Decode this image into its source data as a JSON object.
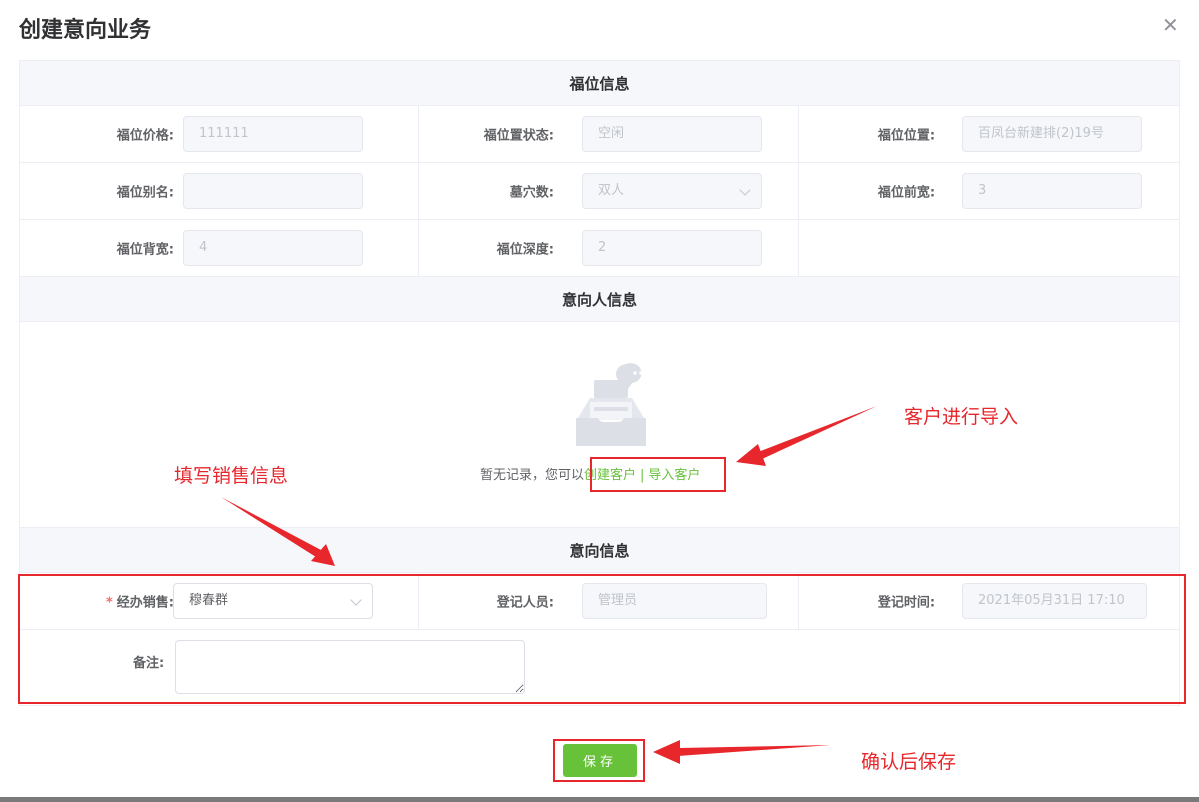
{
  "dialog": {
    "title": "创建意向业务"
  },
  "plot_section": {
    "title": "福位信息",
    "fields": [
      {
        "label": "福位价格:",
        "value": "111111"
      },
      {
        "label": "福位置状态:",
        "value": "空闲"
      },
      {
        "label": "福位位置:",
        "value": "百凤台新建排(2)19号"
      },
      {
        "label": "福位别名:",
        "value": ""
      },
      {
        "label": "墓穴数:",
        "value": "双人"
      },
      {
        "label": "福位前宽:",
        "value": "3"
      },
      {
        "label": "福位背宽:",
        "value": "4"
      },
      {
        "label": "福位深度:",
        "value": "2"
      }
    ]
  },
  "intent_person": {
    "title": "意向人信息",
    "empty_text": "暂无记录，您可以",
    "create_link": "创建客户",
    "separator": "|",
    "import_link": "导入客户"
  },
  "intent_info": {
    "title": "意向信息",
    "sales_label": "经办销售:",
    "sales_required_mark": "*",
    "sales_value": "穆春群",
    "registrar_label": "登记人员:",
    "registrar_value": "管理员",
    "reg_time_label": "登记时间:",
    "reg_time_value": "2021年05月31日 17:10",
    "remark_label": "备注:",
    "remark_value": ""
  },
  "actions": {
    "save_label": "保存"
  },
  "annotations": {
    "import_note": "客户进行导入",
    "fill_note": "填写销售信息",
    "save_note": "确认后保存"
  },
  "colors": {
    "accent_green": "#67c23a",
    "annotation_red": "#e8272c"
  }
}
